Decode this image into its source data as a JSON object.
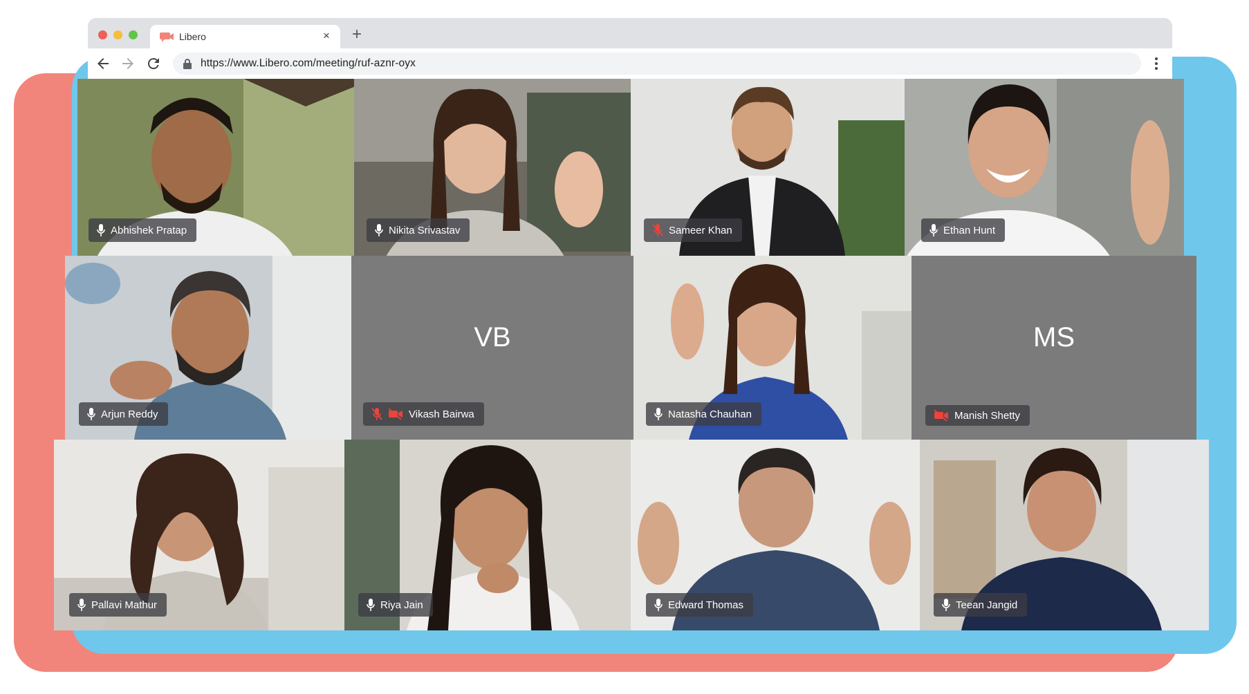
{
  "browser": {
    "tab_title": "Libero",
    "close_glyph": "×",
    "new_tab_glyph": "+",
    "url": "https://www.Libero.com/meeting/ruf-aznr-oyx",
    "brand_color": "#f2857b"
  },
  "participants": [
    {
      "name": "Abhishek Pratap",
      "mic": "on",
      "video": "on"
    },
    {
      "name": "Nikita Srivastav",
      "mic": "on",
      "video": "on"
    },
    {
      "name": "Sameer Khan",
      "mic": "muted",
      "video": "on"
    },
    {
      "name": "Ethan Hunt",
      "mic": "on",
      "video": "on"
    },
    {
      "name": "Arjun Reddy",
      "mic": "on",
      "video": "on"
    },
    {
      "name": "Vikash Bairwa",
      "initials": "VB",
      "mic": "muted",
      "video": "off"
    },
    {
      "name": "Natasha Chauhan",
      "mic": "on",
      "video": "on"
    },
    {
      "name": "Manish Shetty",
      "initials": "MS",
      "video": "off"
    },
    {
      "name": "Pallavi Mathur",
      "mic": "on",
      "video": "on"
    },
    {
      "name": "Riya Jain",
      "mic": "on",
      "video": "on"
    },
    {
      "name": "Edward Thomas",
      "mic": "on",
      "video": "on"
    },
    {
      "name": "Teean Jangid",
      "mic": "on",
      "video": "on"
    }
  ],
  "colors": {
    "frame_coral": "#f2857b",
    "frame_blue": "#6fc7ec",
    "video_off_tile": "#7b7b7b",
    "muted_icon": "#e8453c"
  },
  "icons": [
    "microphone-icon",
    "microphone-muted-icon",
    "camera-off-icon",
    "back-arrow-icon",
    "forward-arrow-icon",
    "reload-icon",
    "lock-icon",
    "more-vert-icon"
  ]
}
